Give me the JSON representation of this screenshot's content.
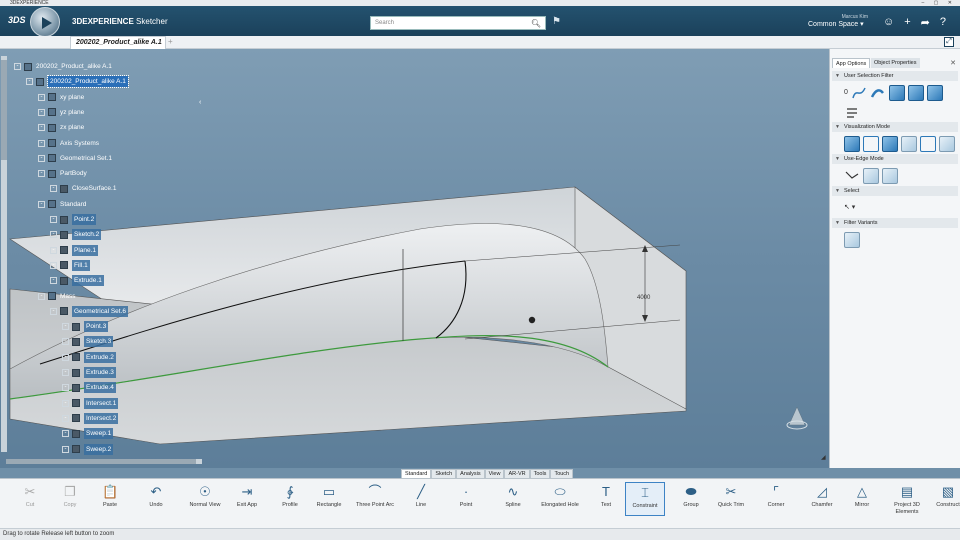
{
  "window": {
    "title": "3DEXPERIENCE",
    "controls": "– ▢ ✕"
  },
  "header": {
    "brand_logo": "3DS",
    "app_brand": "3DEXPERIENCE",
    "app_name": "Sketcher",
    "search_placeholder": "Search",
    "user_name": "Marcus Kim",
    "space": "Common Space ▾"
  },
  "tabs": {
    "document": "200202_Product_alike A.1",
    "add": "+"
  },
  "tree": [
    {
      "label": "200202_Product_alike A.1",
      "level": 0
    },
    {
      "label": "200202_Product_alike A.1",
      "level": 1,
      "selected": true
    },
    {
      "label": "xy plane",
      "level": 2
    },
    {
      "label": "yz plane",
      "level": 2
    },
    {
      "label": "zx plane",
      "level": 2
    },
    {
      "label": "Axis Systems",
      "level": 2
    },
    {
      "label": "Geometrical Set.1",
      "level": 2
    },
    {
      "label": "PartBody",
      "level": 2
    },
    {
      "label": "CloseSurface.1",
      "level": 3
    },
    {
      "label": "Standard",
      "level": 2
    },
    {
      "label": "Point.2",
      "level": 3,
      "highlight": true
    },
    {
      "label": "Sketch.2",
      "level": 3,
      "highlight": true
    },
    {
      "label": "Plane.1",
      "level": 3,
      "highlight": true
    },
    {
      "label": "Fill.1",
      "level": 3,
      "highlight": true
    },
    {
      "label": "Extrude.1",
      "level": 3,
      "highlight": true
    },
    {
      "label": "Mass",
      "level": 2
    },
    {
      "label": "Geometrical Set.6",
      "level": 3,
      "highlight": true
    },
    {
      "label": "Point.3",
      "level": 4,
      "highlight": true
    },
    {
      "label": "Sketch.3",
      "level": 4,
      "highlight": true
    },
    {
      "label": "Extrude.2",
      "level": 4,
      "highlight": true
    },
    {
      "label": "Extrude.3",
      "level": 4,
      "highlight": true
    },
    {
      "label": "Extrude.4",
      "level": 4,
      "highlight": true
    },
    {
      "label": "Intersect.1",
      "level": 4,
      "highlight": true
    },
    {
      "label": "Intersect.2",
      "level": 4,
      "highlight": true
    },
    {
      "label": "Sweep.1",
      "level": 4,
      "highlight": true
    },
    {
      "label": "Sweep.2",
      "level": 4,
      "highlight": true
    }
  ],
  "viewport": {
    "dimension_label": "4000"
  },
  "right_panel": {
    "tab_app_options": "App Options",
    "tab_object_properties": "Object Properties",
    "close": "✕",
    "user_selection_filter": "User Selection Filter",
    "visualization_mode": "Visualization Mode",
    "use_edge_mode": "Use-Edge Mode",
    "select": "Select",
    "filter_variants": "Filter Variants",
    "filter_zero": "0"
  },
  "bottom_tabs": [
    "Standard",
    "Sketch",
    "Analysis",
    "View",
    "AR-VR",
    "Tools",
    "Touch"
  ],
  "action_bar": [
    {
      "label": "Cut",
      "icon": "scissors-icon",
      "dim": true
    },
    {
      "label": "Copy",
      "icon": "copy-icon",
      "dim": true
    },
    {
      "label": "Paste",
      "icon": "paste-icon"
    },
    {
      "label": "Undo",
      "icon": "undo-icon"
    },
    {
      "label": "Normal View",
      "icon": "normal-view-icon"
    },
    {
      "label": "Exit App",
      "icon": "exit-app-icon"
    },
    {
      "label": "Profile",
      "icon": "profile-icon"
    },
    {
      "label": "Rectangle",
      "icon": "rectangle-icon"
    },
    {
      "label": "Three Point Arc",
      "icon": "arc-icon"
    },
    {
      "label": "Line",
      "icon": "line-icon"
    },
    {
      "label": "Point",
      "icon": "point-icon"
    },
    {
      "label": "Spline",
      "icon": "spline-icon"
    },
    {
      "label": "Elongated Hole",
      "icon": "elongated-hole-icon"
    },
    {
      "label": "Text",
      "icon": "text-icon"
    },
    {
      "label": "Constraint",
      "icon": "constraint-icon",
      "active": true
    },
    {
      "label": "Group",
      "icon": "group-icon"
    },
    {
      "label": "Quick Trim",
      "icon": "quick-trim-icon"
    },
    {
      "label": "Corner",
      "icon": "corner-icon"
    },
    {
      "label": "Chamfer",
      "icon": "chamfer-icon"
    },
    {
      "label": "Mirror",
      "icon": "mirror-icon"
    },
    {
      "label": "Project 3D Elements",
      "icon": "project-3d-icon"
    },
    {
      "label": "Construct",
      "icon": "construct-icon"
    }
  ],
  "status": "Drag to rotate  Release left button to zoom",
  "colors": {
    "header": "#1f4a66",
    "selection": "#2a6fb8",
    "viewport": "#6f8fa8"
  }
}
